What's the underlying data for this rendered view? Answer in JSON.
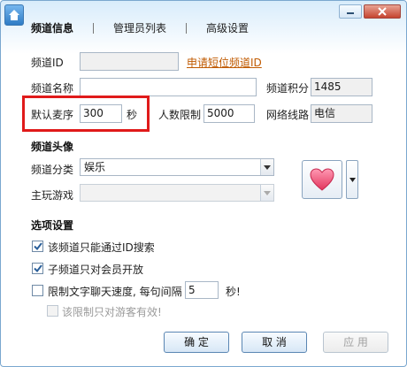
{
  "tabs": [
    {
      "label": "频道信息",
      "active": true
    },
    {
      "label": "管理员列表",
      "active": false
    },
    {
      "label": "高级设置",
      "active": false
    }
  ],
  "basic": {
    "channel_id_label": "频道ID",
    "channel_id_value": "",
    "apply_short_id_link": "申请短位频道ID",
    "channel_name_label": "频道名称",
    "channel_name_value": "",
    "channel_points_label": "频道积分",
    "channel_points_value": "1485",
    "default_mic_label": "默认麦序",
    "default_mic_value": "300",
    "default_mic_unit": "秒",
    "user_limit_label": "人数限制",
    "user_limit_value": "5000",
    "network_label": "网络线路",
    "network_value": "电信"
  },
  "avatar_section": {
    "title": "频道头像",
    "category_label": "频道分类",
    "category_value": "娱乐",
    "main_game_label": "主玩游戏",
    "main_game_value": "",
    "avatar_icon": "heart-icon"
  },
  "options": {
    "title": "选项设置",
    "search_by_id_only": {
      "label": "该频道只能通过ID搜索",
      "checked": true
    },
    "members_only": {
      "label": "子频道只对会员开放",
      "checked": true
    },
    "limit_chat_speed": {
      "label": "限制文字聊天速度, 每句间隔",
      "checked": false,
      "interval": "5",
      "unit": "秒!"
    },
    "guest_only": {
      "label": "该限制只对游客有效!",
      "checked": false
    }
  },
  "buttons": {
    "ok": "确 定",
    "cancel": "取 消",
    "apply": "应 用"
  },
  "colors": {
    "highlight": "#e01a1a",
    "link": "#c05a00",
    "accent": "#2f7cc5"
  }
}
